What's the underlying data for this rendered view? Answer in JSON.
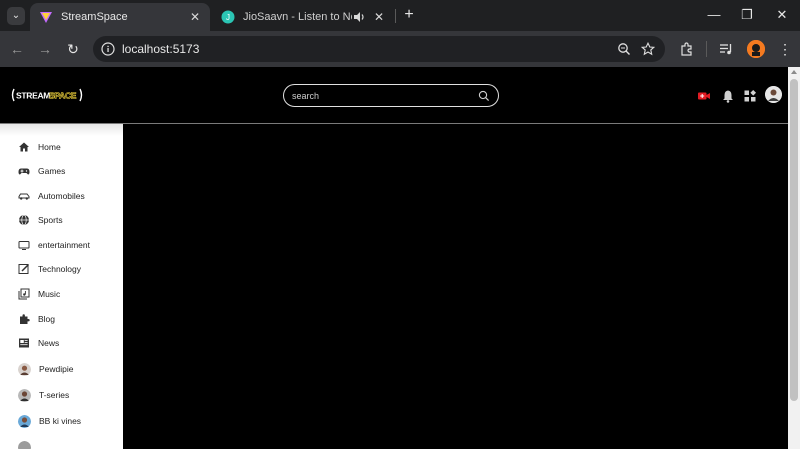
{
  "browser": {
    "tabs": [
      {
        "title": "StreamSpace",
        "active": true
      },
      {
        "title": "JioSaavn - Listen to New & Ol",
        "active": false,
        "audio": true
      }
    ],
    "address": "localhost:5173",
    "icons": [
      "tab-search-icon",
      "new-tab-icon",
      "minimize-icon",
      "restore-icon",
      "close-icon",
      "back-icon",
      "forward-icon",
      "reload-icon",
      "site-info-icon",
      "zoom-icon",
      "bookmark-star-icon",
      "extensions-icon",
      "media-control-icon",
      "profile-icon",
      "menu-icon"
    ]
  },
  "app": {
    "logo_text": "STREAMSPACE",
    "search": {
      "placeholder": "search"
    },
    "header_icons": [
      "video-camera-icon",
      "bell-icon",
      "apps-grid-icon",
      "user-avatar"
    ],
    "colors": {
      "accent": "#e21b23",
      "logo_yellow": "#f2d53c",
      "background": "#000000",
      "sidebar": "#ffffff"
    }
  },
  "sidebar": {
    "items": [
      {
        "label": "Home",
        "icon": "home-icon"
      },
      {
        "label": "Games",
        "icon": "gamepad-icon"
      },
      {
        "label": "Automobiles",
        "icon": "car-icon"
      },
      {
        "label": "Sports",
        "icon": "globe-icon"
      },
      {
        "label": "entertainment",
        "icon": "tv-icon"
      },
      {
        "label": "Technology",
        "icon": "edit-icon"
      },
      {
        "label": "Music",
        "icon": "music-library-icon"
      },
      {
        "label": "Blog",
        "icon": "puzzle-icon"
      },
      {
        "label": "News",
        "icon": "newspaper-icon"
      }
    ],
    "channels": [
      {
        "label": "Pewdipie"
      },
      {
        "label": "T-series"
      },
      {
        "label": "BB ki vines"
      }
    ]
  }
}
